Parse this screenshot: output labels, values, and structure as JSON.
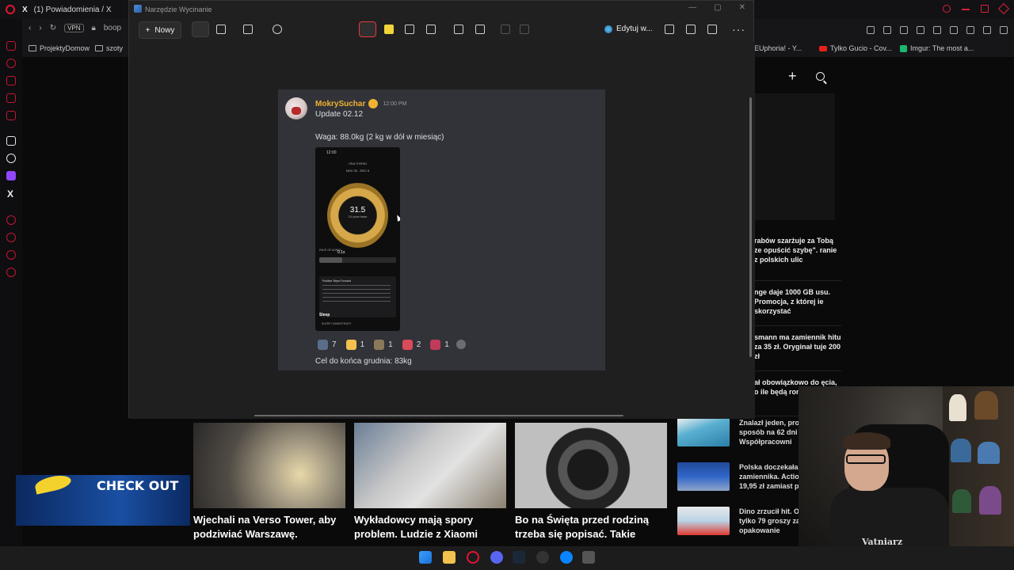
{
  "browser": {
    "tab_title": "(1) Powiadomienia / X",
    "url_fragment": "boop",
    "vpn_label": "VPN",
    "bookmarks": [
      "ProjektyDomow",
      "szoty"
    ],
    "right_bookmarks": [
      "EUphoria! - Y...",
      "Tylko Gucio - Cov...",
      "Imgur: The most a..."
    ]
  },
  "snipping_tool": {
    "window_title": "Narzędzie Wycinanie",
    "new_label": "Nowy",
    "edit_label": "Edytuj w..."
  },
  "message": {
    "username": "MokrySuchar",
    "timestamp": "12:00 PM",
    "line1": "Update 02.12",
    "line2": "Waga: 88.0kg (2 kg w dół w miesiąc)",
    "footer": "Cel do końca grudnia: 83kg",
    "reactions": [
      {
        "icon": "team-emoji",
        "count": "7",
        "color": "#5a6e8a"
      },
      {
        "icon": "thumbs-up-emoji",
        "count": "1",
        "color": "#f2c14e"
      },
      {
        "icon": "cat-emoji",
        "count": "1",
        "color": "#8a7a5a"
      },
      {
        "icon": "lips-emoji",
        "count": "2",
        "color": "#d94a5a"
      },
      {
        "icon": "party-emoji",
        "count": "1",
        "color": "#c23a5a"
      }
    ]
  },
  "phone": {
    "time": "12:00",
    "title": "HEALTHSPAN",
    "date_range": "NOV 30 - DEC 6",
    "value": "31.5",
    "value_sub": "3.5 years faster",
    "pace_label": "PACE OF AGING",
    "pace_value": "0.1x",
    "pace_fill_percent": 30,
    "card_title": "Positive Steps Forward",
    "sleep_label": "Sleep",
    "sleep_sub": "SLEEP CONSISTENCY"
  },
  "news_right": [
    "rabów szarżuje za Tobą ze opuścić szybę\". ranie z polskich ulic",
    "nge daje 1000 GB usu. Promocja, z której ie skorzystać",
    "smann ma zamiennik hitu za 35 zł. Oryginał tuje 200 zł",
    "ał obowiązkowo do ęcia, o ile będą ronka robi pr"
  ],
  "news_cards": [
    {
      "title": "Wjechali na Verso Tower, aby podziwiać Warszawę."
    },
    {
      "title": "Wykładowcy mają spory problem. Ludzie z Xiaomi"
    },
    {
      "title": "Bo na Święta przed rodziną trzeba się popisać. Takie"
    }
  ],
  "side_news": [
    {
      "text": "Znalazł jeden, pro sposób na 62 dni Współpracowni"
    },
    {
      "text": "Polska doczekała zamiennika. Actio 19,95 zł zamiast p"
    },
    {
      "text": "Dino zrzucił hit. O tylko 79 groszy za opakowanie"
    }
  ],
  "promo_text": "CHECK OUT",
  "webcam_shirt_text": "Vatniarz"
}
